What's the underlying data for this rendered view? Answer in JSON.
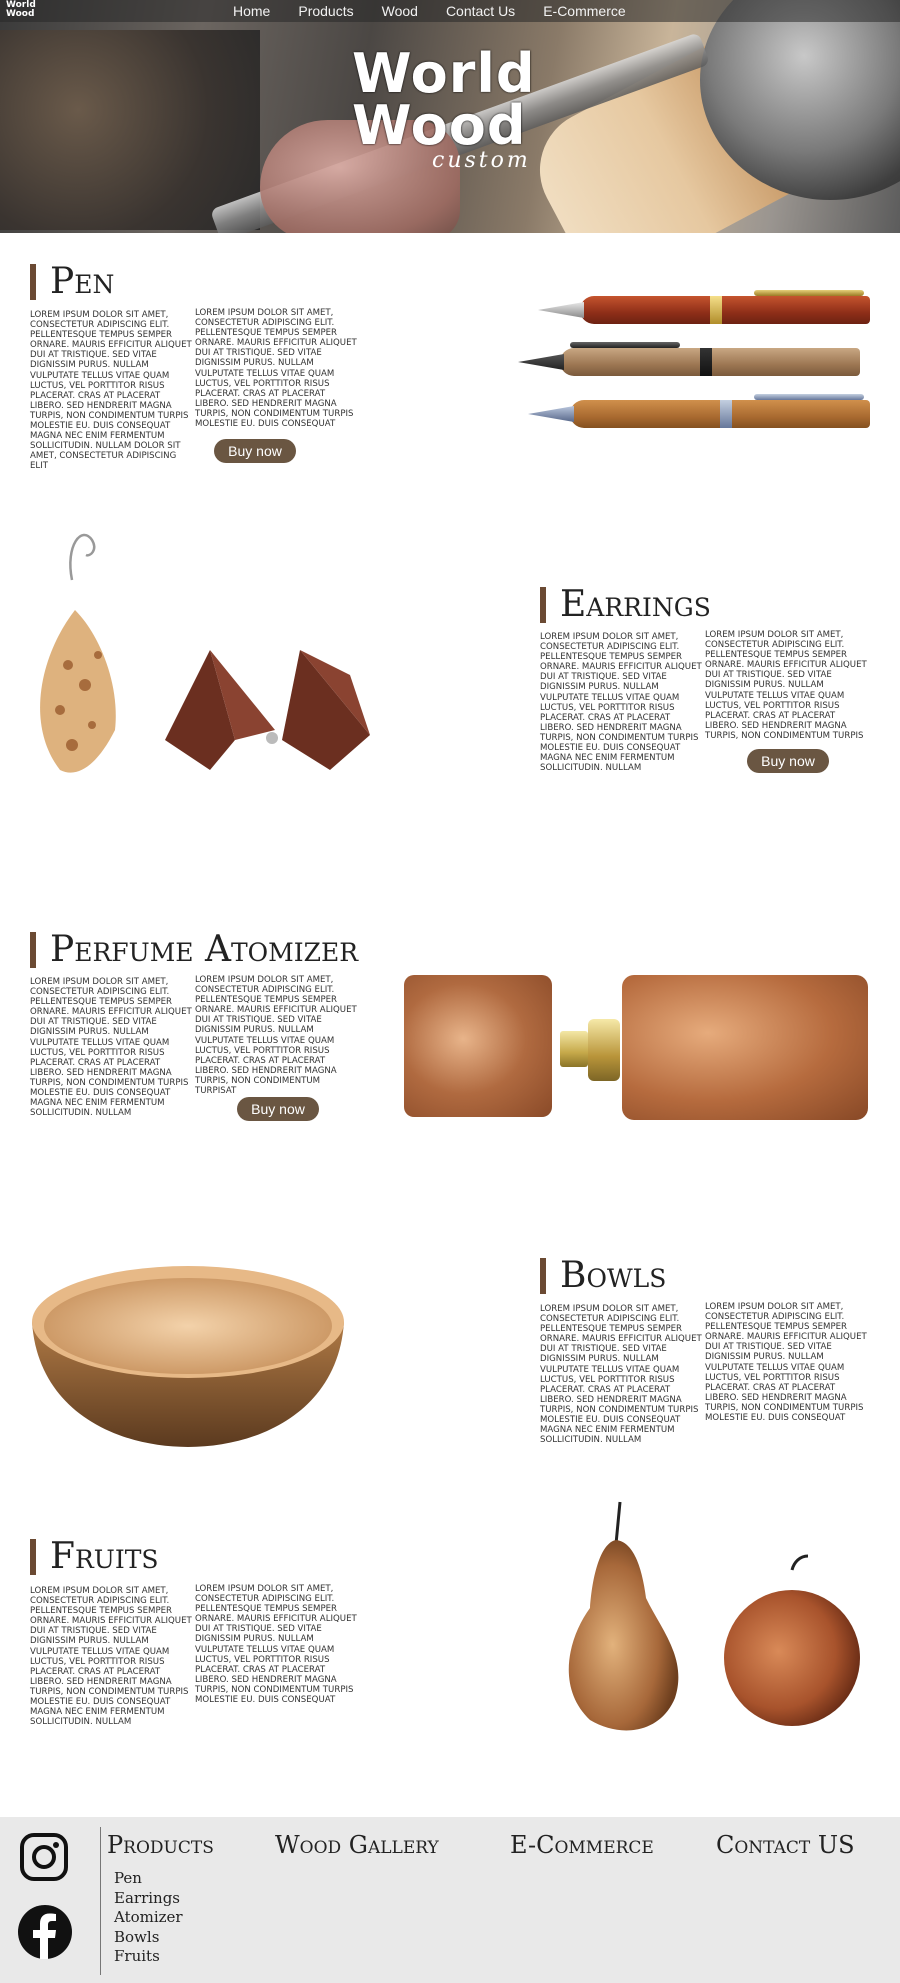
{
  "nav": {
    "logo_line1": "World",
    "logo_line2": "Wood",
    "links": [
      "Home",
      "Products",
      "Wood",
      "Contact Us",
      "E-Commerce"
    ]
  },
  "hero": {
    "logo_line1": "World",
    "logo_line2": "Wood",
    "logo_line3": "custom"
  },
  "sections": {
    "pen": {
      "title": "Pen",
      "col1": "Lorem ipsum dolor sit amet, consectetur adipiscing elit. Pellentesque tempus semper ornare. Mauris efficitur aliquet dui at tristique. Sed vitae dignissim purus. Nullam vulputate tellus vitae quam luctus, vel porttitor risus placerat. Cras at placerat libero. Sed hendrerit magna turpis, non condimentum turpis molestie eu. Duis consequat magna nec enim fermentum sollicitudin. Nullam dolor sit amet, consectetur adipiscing elit",
      "col2": "Lorem ipsum dolor sit amet, consectetur adipiscing elit. Pellentesque tempus semper ornare. Mauris efficitur aliquet dui at tristique. Sed vitae dignissim purus. Nullam vulputate tellus vitae quam luctus, vel porttitor risus placerat. Cras at placerat libero. Sed hendrerit magna turpis, non condimentum turpis molestie eu. Duis consequat",
      "button": "Buy now"
    },
    "earrings": {
      "title": "Earrings",
      "col1": "Lorem ipsum dolor sit amet, consectetur adipiscing elit. Pellentesque tempus semper ornare. Mauris efficitur aliquet dui at tristique. Sed vitae dignissim purus. Nullam vulputate tellus vitae quam luctus, vel porttitor risus placerat. Cras at placerat libero. Sed hendrerit magna turpis, non condimentum turpis molestie eu. Duis consequat magna nec enim fermentum sollicitudin. Nullam",
      "col2": "Lorem ipsum dolor sit amet, consectetur adipiscing elit. Pellentesque tempus semper ornare. Mauris efficitur aliquet dui at tristique. Sed vitae dignissim purus. Nullam vulputate tellus vitae quam luctus, vel porttitor risus placerat. Cras at placerat libero. Sed hendrerit magna turpis, non condimentum turpis",
      "button": "Buy now"
    },
    "atomizer": {
      "title": "Perfume Atomizer",
      "col1": "Lorem ipsum dolor sit amet, consectetur adipiscing elit. Pellentesque tempus semper ornare. Mauris efficitur aliquet dui at tristique. Sed vitae dignissim purus. Nullam vulputate tellus vitae quam luctus, vel porttitor risus placerat. Cras at placerat libero. Sed hendrerit magna turpis, non condimentum turpis molestie eu. Duis consequat magna nec enim fermentum sollicitudin. Nullam",
      "col2": "Lorem ipsum dolor sit amet, consectetur adipiscing elit. Pellentesque tempus semper ornare. Mauris efficitur aliquet dui at tristique. Sed vitae dignissim purus. Nullam vulputate tellus vitae quam luctus, vel porttitor risus placerat. Cras at placerat libero. Sed hendrerit magna turpis, non condimentum turpisat",
      "button": "Buy now"
    },
    "bowls": {
      "title": "Bowls",
      "col1": "Lorem ipsum dolor sit amet, consectetur adipiscing elit. Pellentesque tempus semper ornare. Mauris efficitur aliquet dui at tristique. Sed vitae dignissim purus. Nullam vulputate tellus vitae quam luctus, vel porttitor risus placerat. Cras at placerat libero. Sed hendrerit magna turpis, non condimentum turpis molestie eu. Duis consequat magna nec enim fermentum sollicitudin. Nullam",
      "col2": "Lorem ipsum dolor sit amet, consectetur adipiscing elit. Pellentesque tempus semper ornare. Mauris efficitur aliquet dui at tristique. Sed vitae dignissim purus. Nullam vulputate tellus vitae quam luctus, vel porttitor risus placerat. Cras at placerat libero. Sed hendrerit magna turpis, non condimentum turpis molestie eu. Duis consequat"
    },
    "fruits": {
      "title": "Fruits",
      "col1": "Lorem ipsum dolor sit amet, consectetur adipiscing elit. Pellentesque tempus semper ornare. Mauris efficitur aliquet dui at tristique. Sed vitae dignissim purus. Nullam vulputate tellus vitae quam luctus, vel porttitor risus placerat. Cras at placerat libero. Sed hendrerit magna turpis, non condimentum turpis molestie eu. Duis consequat magna nec enim fermentum sollicitudin. Nullam",
      "col2": "Lorem ipsum dolor sit amet, consectetur adipiscing elit. Pellentesque tempus semper ornare. Mauris efficitur aliquet dui at tristique. Sed vitae dignissim purus. Nullam vulputate tellus vitae quam luctus, vel porttitor risus placerat. Cras at placerat libero. Sed hendrerit magna turpis, non condimentum turpis molestie eu. Duis consequat"
    }
  },
  "footer": {
    "products_heading": "Products",
    "products": [
      "Pen",
      "Earrings",
      "Atomizer",
      "Bowls",
      "Fruits"
    ],
    "gallery_heading": "Wood Gallery",
    "ecommerce_heading": "E-Commerce",
    "contact_heading": "Contact US",
    "social_icons": [
      "instagram-icon",
      "facebook-icon"
    ]
  },
  "colors": {
    "accent_brown": "#6b4a33",
    "button_brown": "#6a5642",
    "footer_bg": "#e9e9e9"
  }
}
